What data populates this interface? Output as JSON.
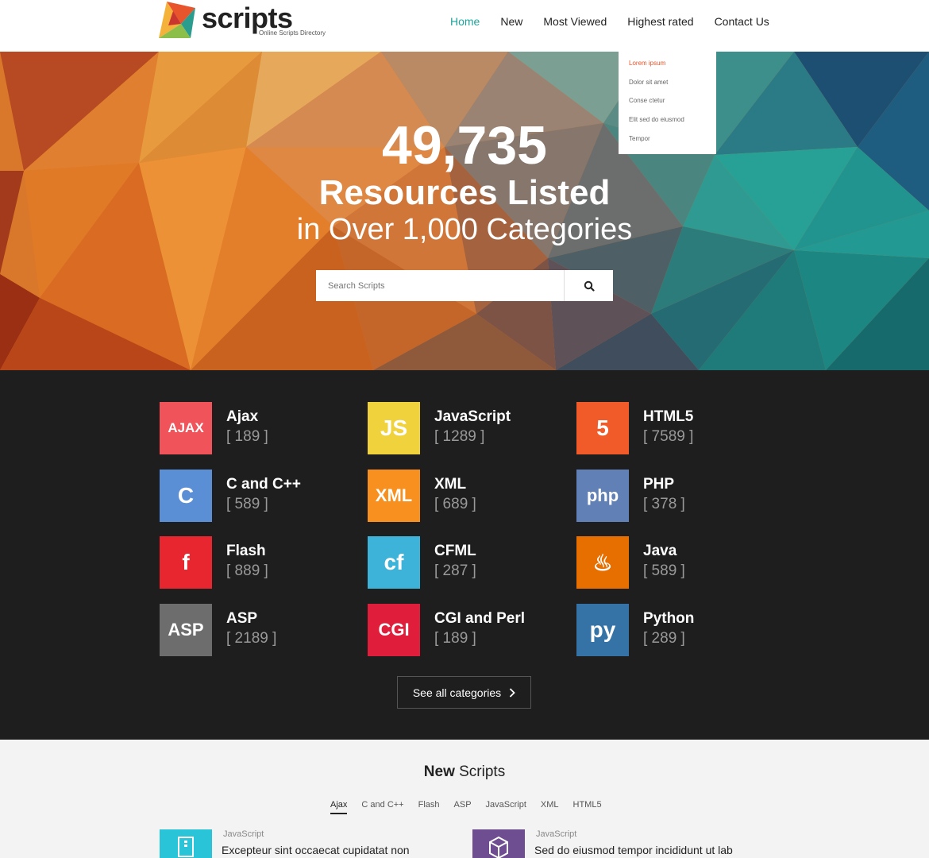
{
  "header": {
    "logo_text": "scripts",
    "logo_tagline": "Online Scripts Directory",
    "nav": [
      {
        "label": "Home",
        "active": true
      },
      {
        "label": "New"
      },
      {
        "label": "Most Viewed"
      },
      {
        "label": "Highest rated"
      },
      {
        "label": "Contact Us"
      }
    ],
    "dropdown": [
      "Lorem ipsum",
      "Dolor sit amet",
      "Conse ctetur",
      "Elit sed do eiusmod",
      "Tempor"
    ]
  },
  "hero": {
    "count": "49,735",
    "line1": "Resources Listed",
    "line2": "in Over 1,000 Categories",
    "search_placeholder": "Search Scripts"
  },
  "categories": [
    {
      "name": "Ajax",
      "count": "[ 189 ]",
      "icon": "ajax-icon",
      "color": "#f0545a",
      "glyph": "AJAX"
    },
    {
      "name": "JavaScript",
      "count": "[ 1289 ]",
      "icon": "javascript-icon",
      "color": "#f0d23c",
      "glyph": "JS"
    },
    {
      "name": "HTML5",
      "count": "[ 7589 ]",
      "icon": "html5-icon",
      "color": "#f15a29",
      "glyph": "5"
    },
    {
      "name": "C and C++",
      "count": "[ 589 ]",
      "icon": "cpp-icon",
      "color": "#5a8fd6",
      "glyph": "C"
    },
    {
      "name": "XML",
      "count": "[ 689 ]",
      "icon": "xml-icon",
      "color": "#f7901e",
      "glyph": "XML"
    },
    {
      "name": "PHP",
      "count": "[ 378 ]",
      "icon": "php-icon",
      "color": "#6181b6",
      "glyph": "php"
    },
    {
      "name": "Flash",
      "count": "[ 889 ]",
      "icon": "flash-icon",
      "color": "#e8262f",
      "glyph": "f"
    },
    {
      "name": "CFML",
      "count": "[ 287 ]",
      "icon": "cfml-icon",
      "color": "#3db3d9",
      "glyph": "cf"
    },
    {
      "name": "Java",
      "count": "[ 589 ]",
      "icon": "java-icon",
      "color": "#e76f00",
      "glyph": "♨"
    },
    {
      "name": "ASP",
      "count": "[ 2189 ]",
      "icon": "asp-icon",
      "color": "#6d6d6d",
      "glyph": "ASP"
    },
    {
      "name": "CGI and Perl",
      "count": "[ 189 ]",
      "icon": "cgi-icon",
      "color": "#e01e3c",
      "glyph": "CGI"
    },
    {
      "name": "Python",
      "count": "[ 289 ]",
      "icon": "python-icon",
      "color": "#3572a5",
      "glyph": "py"
    }
  ],
  "see_all_label": "See all categories",
  "new_scripts": {
    "heading_bold": "New",
    "heading_rest": " Scripts",
    "tabs": [
      "Ajax",
      "C and C++",
      "Flash",
      "ASP",
      "JavaScript",
      "XML",
      "HTML5"
    ],
    "active_tab": "Ajax",
    "items": [
      {
        "category": "JavaScript",
        "title": "Excepteur sint occaecat cupidatat non",
        "thumb_color": "#29c4d8",
        "icon": "zip-file-icon"
      },
      {
        "category": "JavaScript",
        "title": "Sed do eiusmod tempor incididunt ut lab",
        "thumb_color": "#6e4d91",
        "icon": "cube-icon"
      }
    ]
  },
  "colors": {
    "accent": "#1fa39a",
    "dark": "#1e1e1e",
    "dropdown_active": "#e8542b"
  }
}
